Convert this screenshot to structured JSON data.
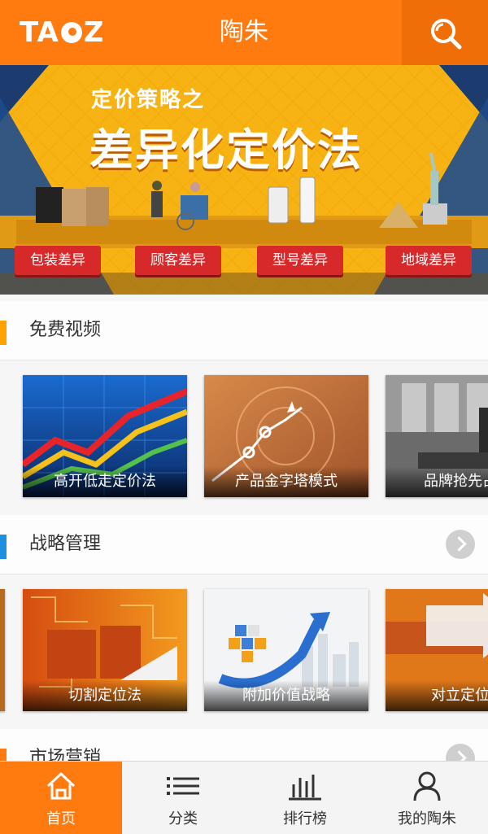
{
  "header": {
    "logo": "TAOZ",
    "title": "陶朱"
  },
  "banner": {
    "subtitle": "定价策略之",
    "headline": "差异化定价法",
    "labels": [
      "包装差异",
      "顾客差异",
      "型号差异",
      "地域差异"
    ]
  },
  "sections": [
    {
      "title": "免费视频",
      "bar_color": "#ffa200",
      "cards": [
        "高开低走定价法",
        "产品金字塔模式",
        "品牌抢先占位"
      ]
    },
    {
      "title": "战略管理",
      "bar_color": "#1b8fe0",
      "cards": [
        "切割定位法",
        "附加价值战略",
        "对立定位法"
      ]
    },
    {
      "title": "市场营销",
      "bar_color": "#ff7a0f"
    }
  ],
  "tabs": [
    "首页",
    "分类",
    "排行榜",
    "我的陶朱"
  ]
}
